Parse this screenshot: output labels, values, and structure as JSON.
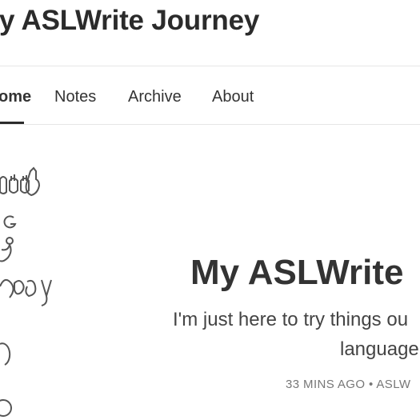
{
  "site": {
    "title": "y ASLWrite Journey"
  },
  "nav": {
    "items": [
      {
        "label": "ome"
      },
      {
        "label": "Notes"
      },
      {
        "label": "Archive"
      },
      {
        "label": "About"
      }
    ]
  },
  "post": {
    "title": "My ASLWrite",
    "excerpt_line1": "I'm just here to try things ou",
    "excerpt_line2": "language",
    "meta": "33 MINS AGO • ASLW"
  }
}
